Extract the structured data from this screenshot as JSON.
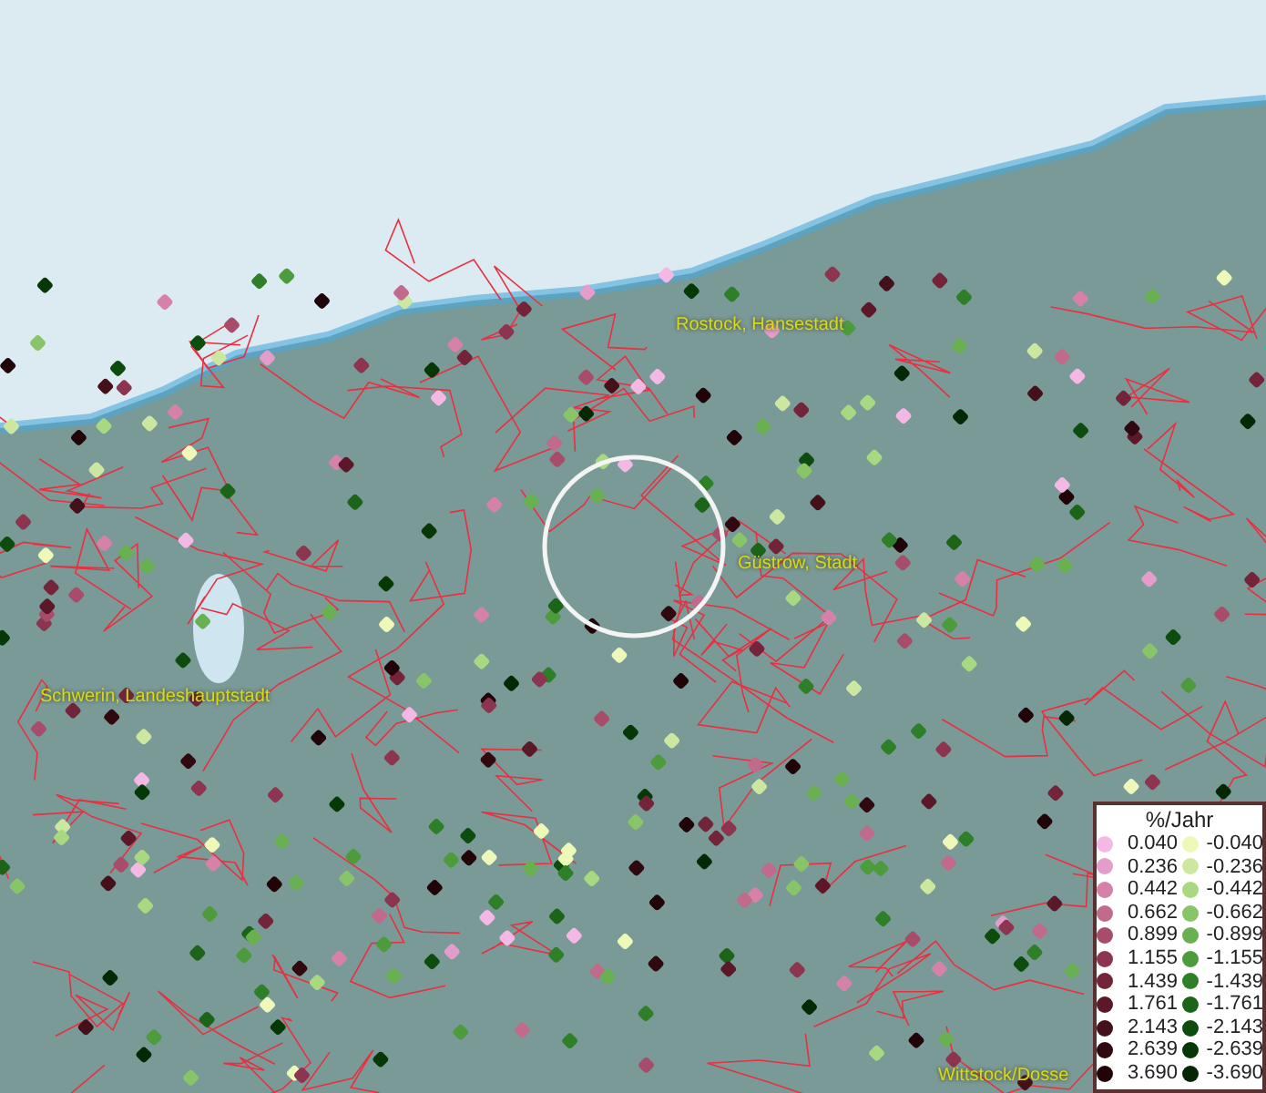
{
  "map": {
    "places": [
      {
        "name": "Rostock, Hansestadt"
      },
      {
        "name": "Güstrow, Stadt"
      },
      {
        "name": "Schwerin, Landeshauptstadt"
      },
      {
        "name": "Wittstock/Dosse"
      }
    ]
  },
  "legend": {
    "title": "%/Jahr",
    "columns": [
      [
        {
          "label": "0.040",
          "color": "#f4b8e4"
        },
        {
          "label": "0.236",
          "color": "#e49ccb"
        },
        {
          "label": "0.442",
          "color": "#d682a8"
        },
        {
          "label": "0.662",
          "color": "#c06a8c"
        },
        {
          "label": "0.899",
          "color": "#a84c6c"
        },
        {
          "label": "1.155",
          "color": "#8c3450"
        },
        {
          "label": "1.439",
          "color": "#74243a"
        },
        {
          "label": "1.761",
          "color": "#5c1828"
        },
        {
          "label": "2.143",
          "color": "#44101a"
        },
        {
          "label": "2.639",
          "color": "#300810"
        },
        {
          "label": "3.690",
          "color": "#200408"
        }
      ],
      [
        {
          "label": "-0.040",
          "color": "#eef8b8"
        },
        {
          "label": "-0.236",
          "color": "#cce8a0"
        },
        {
          "label": "-0.442",
          "color": "#a8d880"
        },
        {
          "label": "-0.662",
          "color": "#88c468"
        },
        {
          "label": "-0.899",
          "color": "#68b050"
        },
        {
          "label": "-1.155",
          "color": "#4c9c3c"
        },
        {
          "label": "-1.439",
          "color": "#2e8028"
        },
        {
          "label": "-1.761",
          "color": "#1c6418"
        },
        {
          "label": "-2.143",
          "color": "#0c4c0c"
        },
        {
          "label": "-2.639",
          "color": "#063806"
        },
        {
          "label": "-3.690",
          "color": "#042804"
        }
      ]
    ]
  }
}
